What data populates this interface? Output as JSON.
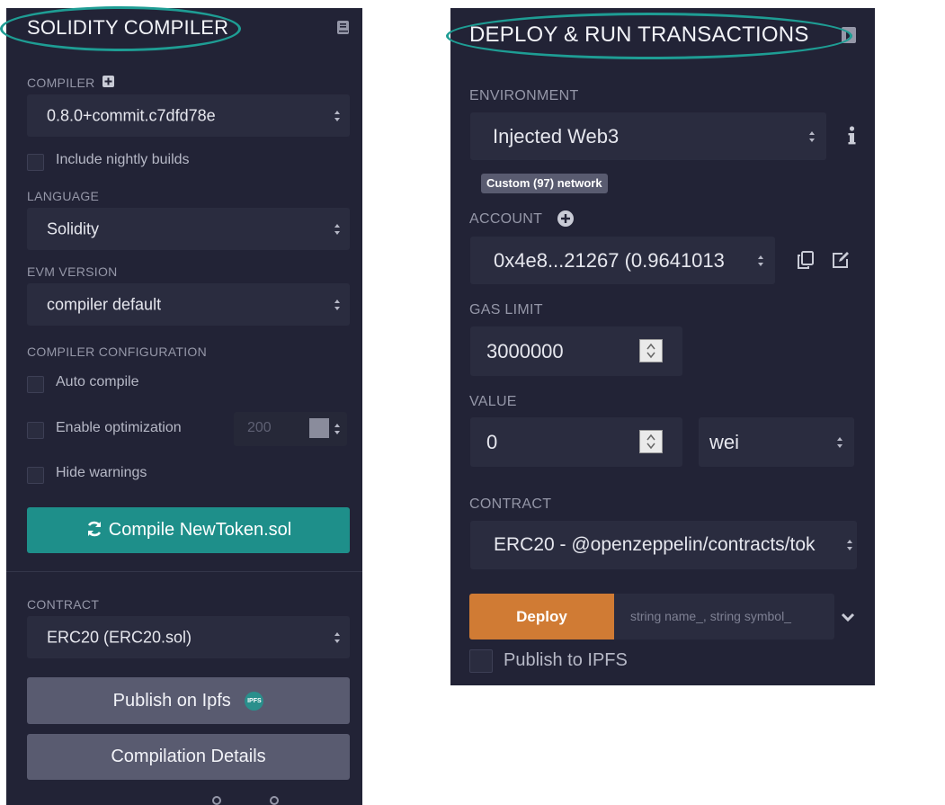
{
  "compiler_panel": {
    "title": "SOLIDITY COMPILER",
    "icons": {
      "header": "book-icon",
      "compiler_add": "plus-square-icon",
      "compile": "refresh-icon",
      "ipfs": "ipfs-icon"
    },
    "compiler_label": "COMPILER",
    "compiler_value": "0.8.0+commit.c7dfd78e",
    "nightly_label": "Include nightly builds",
    "language_label": "LANGUAGE",
    "language_value": "Solidity",
    "evm_label": "EVM VERSION",
    "evm_value": "compiler default",
    "config_label": "COMPILER CONFIGURATION",
    "auto_compile_label": "Auto compile",
    "optimization_label": "Enable optimization",
    "optimization_runs": "200",
    "hide_warnings_label": "Hide warnings",
    "compile_button": "Compile NewToken.sol",
    "contract_label": "CONTRACT",
    "contract_value": "ERC20 (ERC20.sol)",
    "publish_button": "Publish on Ipfs",
    "ipfs_badge": "IPFS",
    "details_button": "Compilation Details"
  },
  "deploy_panel": {
    "title": "DEPLOY & RUN TRANSACTIONS",
    "icons": {
      "header": "plugin-icon",
      "info": "info-icon",
      "account_add": "plus-circle-icon",
      "copy": "copy-icon",
      "edit": "edit-icon",
      "expand": "chevron-down-icon"
    },
    "environment_label": "ENVIRONMENT",
    "environment_value": "Injected Web3",
    "network_badge": "Custom (97) network",
    "account_label": "ACCOUNT",
    "account_value": "0x4e8...21267 (0.9641013",
    "gas_limit_label": "GAS LIMIT",
    "gas_limit_value": "3000000",
    "value_label": "VALUE",
    "value_value": "0",
    "value_unit": "wei",
    "contract_label": "CONTRACT",
    "contract_value": "ERC20 - @openzeppelin/contracts/tok",
    "deploy_button": "Deploy",
    "deploy_args_placeholder": "string name_, string symbol_",
    "publish_ipfs_label": "Publish to IPFS"
  },
  "colors": {
    "panel_bg": "#222336",
    "field_bg": "#2a2c3f",
    "compile_button": "#1e8f8a",
    "deploy_button": "#d07b34",
    "grey_button": "#595b70",
    "highlight_ellipse": "#1e9d94"
  }
}
